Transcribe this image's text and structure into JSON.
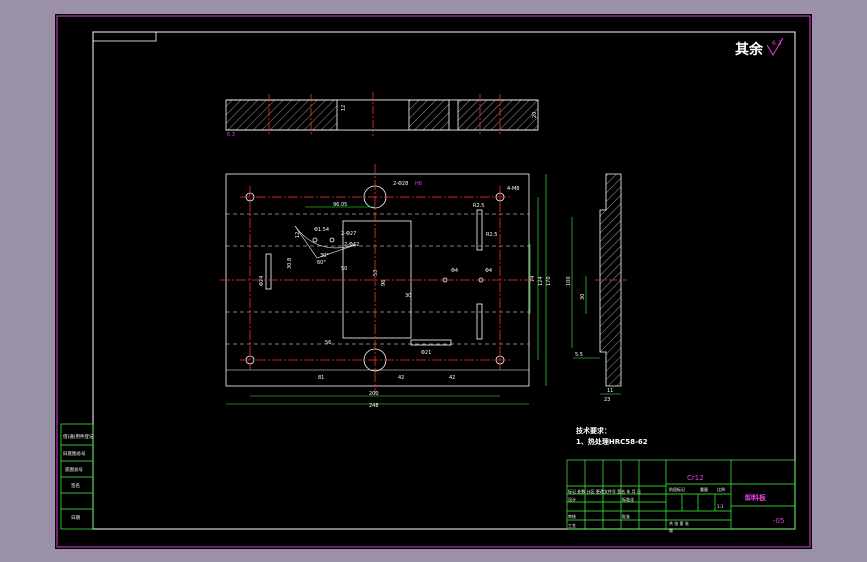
{
  "surface_roughness_label": "其余",
  "roughness_value": "6.3",
  "section_dims": {
    "slot_depth": "12",
    "thickness": "20",
    "corner": "6.3"
  },
  "plan_dims": {
    "hole_callout_big": "2-Φ28",
    "hole_callout_fit": "H8",
    "corner_holes": "4-M8",
    "center_x": "96.05",
    "small_holes_1": "2-Φ27",
    "small_holes_2": "2-Φ42",
    "circle_note": "Φ1.54",
    "angle_1": "30°",
    "angle_2": "60°",
    "dim_30_8": "30.8",
    "dim_50": "50",
    "dim_12": "12",
    "dim_53": "53",
    "dim_32": "32",
    "dim_96": "96",
    "dim_30": "30",
    "hole_phi1": "Φ4",
    "hole_phi2": "Φ4",
    "slot_left": "R2.5",
    "slot_right": "R2.5",
    "vertical_74": "74",
    "vertical_124": "124",
    "vertical_170": "170",
    "bottom_56": "56",
    "bottom_23": "Φ21",
    "bottom_81": "81",
    "bottom_42a": "42",
    "bottom_42b": "42",
    "overall_200": "200",
    "overall_248": "248",
    "left_slot": "Φ24"
  },
  "side_dims": {
    "h_100": "100",
    "h_30": "30",
    "h_5_5": "5.5",
    "w_11": "11",
    "w_23": "23"
  },
  "tech_req_title": "技术要求：",
  "tech_req_line": "1、热处理HRC58-62",
  "title_block": {
    "material": "Cr12",
    "part_name": "卸料板",
    "drawing_no": "-05",
    "scale": "1:1",
    "row_revision": "标记 处数 分区 更改文件号 签名 年 月 日",
    "designer": "设计",
    "standard": "标准化",
    "stage": "阶段标记",
    "weight": "重量",
    "ratio": "比例",
    "check": "审核",
    "process": "工艺",
    "approve": "批准",
    "sheet_info": "共 张 第 张",
    "sheet_label": "版"
  },
  "left_margin_labels": [
    "借(通)用件登记",
    "旧底图总号",
    "底图总号",
    "签名",
    "日期"
  ]
}
